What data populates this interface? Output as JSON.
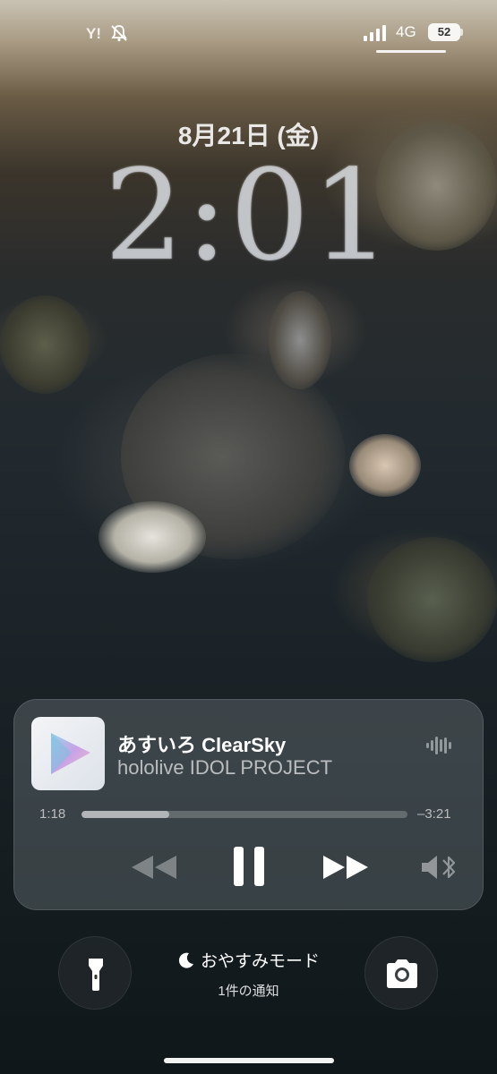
{
  "status_bar": {
    "carrier": "Y!",
    "network": "4G",
    "battery": "52",
    "icons": [
      "bell-slash-icon",
      "signal-icon",
      "battery-icon"
    ]
  },
  "lockscreen": {
    "date": "8月21日 (金)",
    "time": "2:01"
  },
  "now_playing": {
    "title": "あすいろ ClearSky",
    "artist": "hololive IDOL PROJECT",
    "elapsed": "1:18",
    "remaining": "–3:21",
    "progress_fraction": 0.27,
    "icons": {
      "waveform": "waveform-icon",
      "rewind": "rewind-icon",
      "pause": "pause-icon",
      "forward": "fast-forward-icon",
      "output": "speaker-bluetooth-icon"
    }
  },
  "bottom": {
    "focus_mode": "おやすみモード",
    "notification": "1件の通知",
    "icons": {
      "left": "flashlight-icon",
      "right": "camera-icon",
      "focus": "moon-icon"
    }
  }
}
